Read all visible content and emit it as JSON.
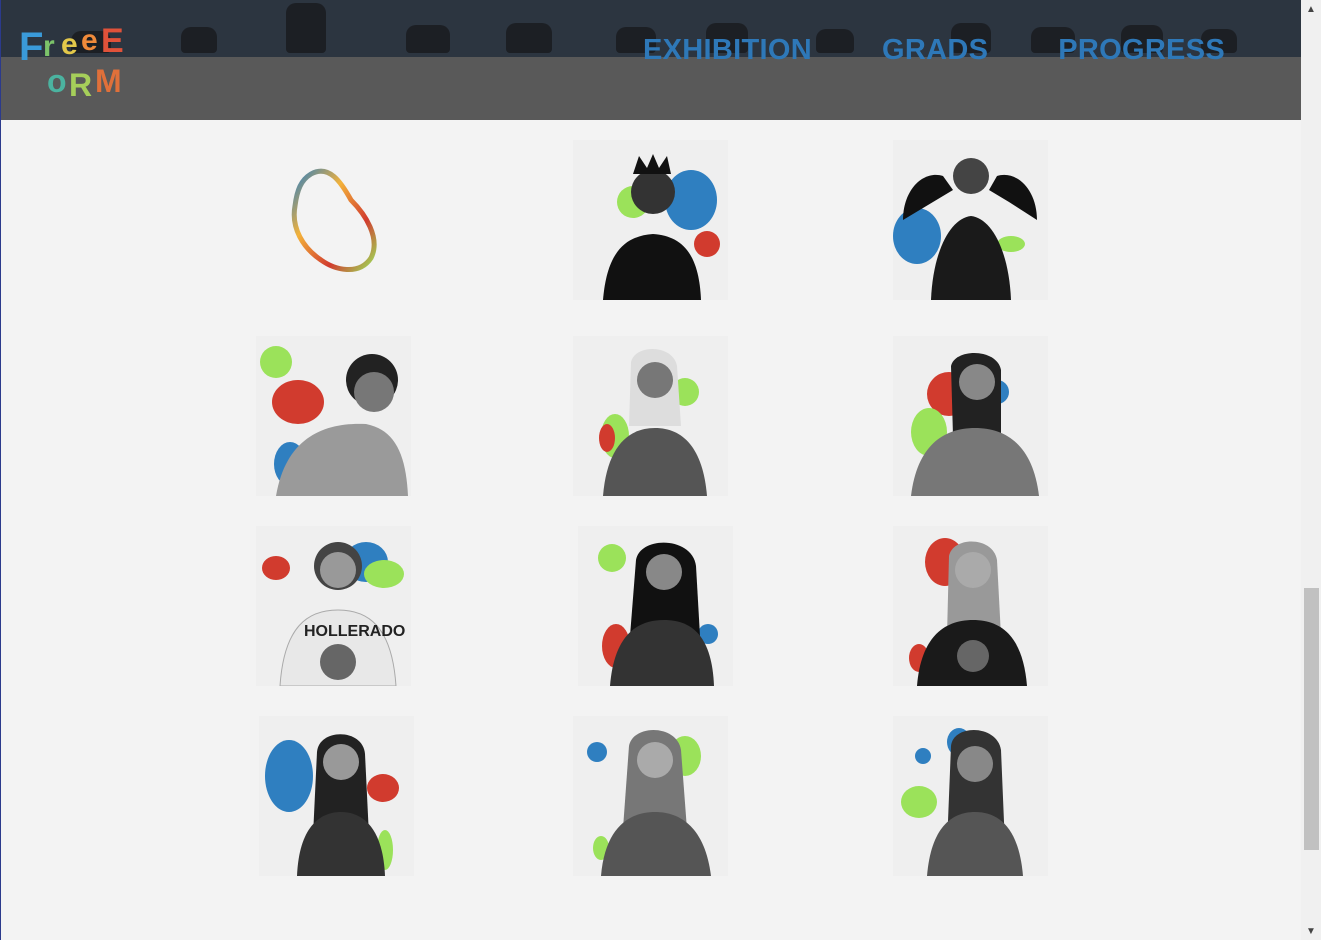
{
  "nav": {
    "items": [
      {
        "label": "EXHIBITION"
      },
      {
        "label": "GRADS"
      },
      {
        "label": "PROGRESS"
      }
    ]
  },
  "logo": {
    "text": "FreeForm"
  },
  "colors": {
    "nav_link": "#2e78b8",
    "header_band": "#2c3540",
    "header_bg": "#595959",
    "page_bg": "#f3f3f3",
    "blob_red": "#d13b2e",
    "blob_blue": "#2f7fc0",
    "blob_green": "#9be25a"
  },
  "grads": [
    {
      "kind": "logo-blob"
    },
    {
      "kind": "portrait"
    },
    {
      "kind": "portrait"
    },
    {
      "kind": "portrait"
    },
    {
      "kind": "portrait"
    },
    {
      "kind": "portrait"
    },
    {
      "kind": "portrait"
    },
    {
      "kind": "portrait"
    },
    {
      "kind": "portrait"
    },
    {
      "kind": "portrait"
    },
    {
      "kind": "portrait"
    },
    {
      "kind": "portrait"
    }
  ]
}
